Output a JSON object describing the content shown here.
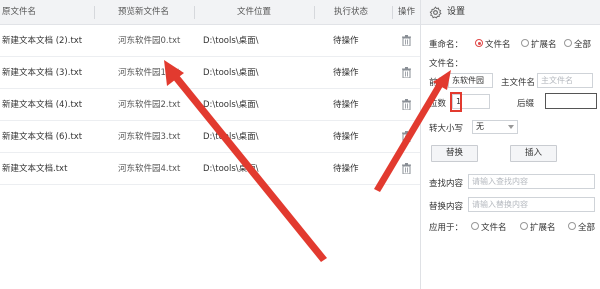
{
  "table": {
    "headers": {
      "original_name": "原文件名",
      "preview_name": "预览新文件名",
      "location": "文件位置",
      "status": "执行状态",
      "action": "操作"
    },
    "rows": [
      {
        "original": "新建文本文档 (2).txt",
        "preview": "河东软件园0.txt",
        "location": "D:\\tools\\桌面\\",
        "status": "待操作"
      },
      {
        "original": "新建文本文档 (3).txt",
        "preview": "河东软件园1.txt",
        "location": "D:\\tools\\桌面\\",
        "status": "待操作"
      },
      {
        "original": "新建文本文档 (4).txt",
        "preview": "河东软件园2.txt",
        "location": "D:\\tools\\桌面\\",
        "status": "待操作"
      },
      {
        "original": "新建文本文档 (6).txt",
        "preview": "河东软件园3.txt",
        "location": "D:\\tools\\桌面\\",
        "status": "待操作"
      },
      {
        "original": "新建文本文档.txt",
        "preview": "河东软件园4.txt",
        "location": "D:\\tools\\桌面\\",
        "status": "待操作"
      }
    ],
    "action_icon": "trash-icon"
  },
  "settings": {
    "title": "设置",
    "title_icon": "gear-icon",
    "rename_label": "重命名：",
    "rename_options": [
      "文件名",
      "扩展名",
      "全部"
    ],
    "rename_selected": "文件名",
    "filename_label": "文件名：",
    "prefix_label": "前缀",
    "prefix_value": "东软件园",
    "main_filename_label": "主文件名",
    "main_filename_placeholder": "主文件名",
    "digits_label": "位数",
    "digits_value": "1",
    "suffix_label": "后缀",
    "suffix_value": "",
    "case_label": "转大小写",
    "case_value": "无",
    "replace_button": "替换",
    "insert_button": "插入",
    "find_label": "查找内容",
    "find_placeholder": "请输入查找内容",
    "replace_label": "替换内容",
    "replace_placeholder": "请输入替换内容",
    "apply_label": "应用于：",
    "apply_options": [
      "文件名",
      "扩展名",
      "全部"
    ]
  },
  "colors": {
    "accent_red": "#e04848",
    "arrow_red": "#e23a2f",
    "header_bg": "#f2f3f5"
  }
}
